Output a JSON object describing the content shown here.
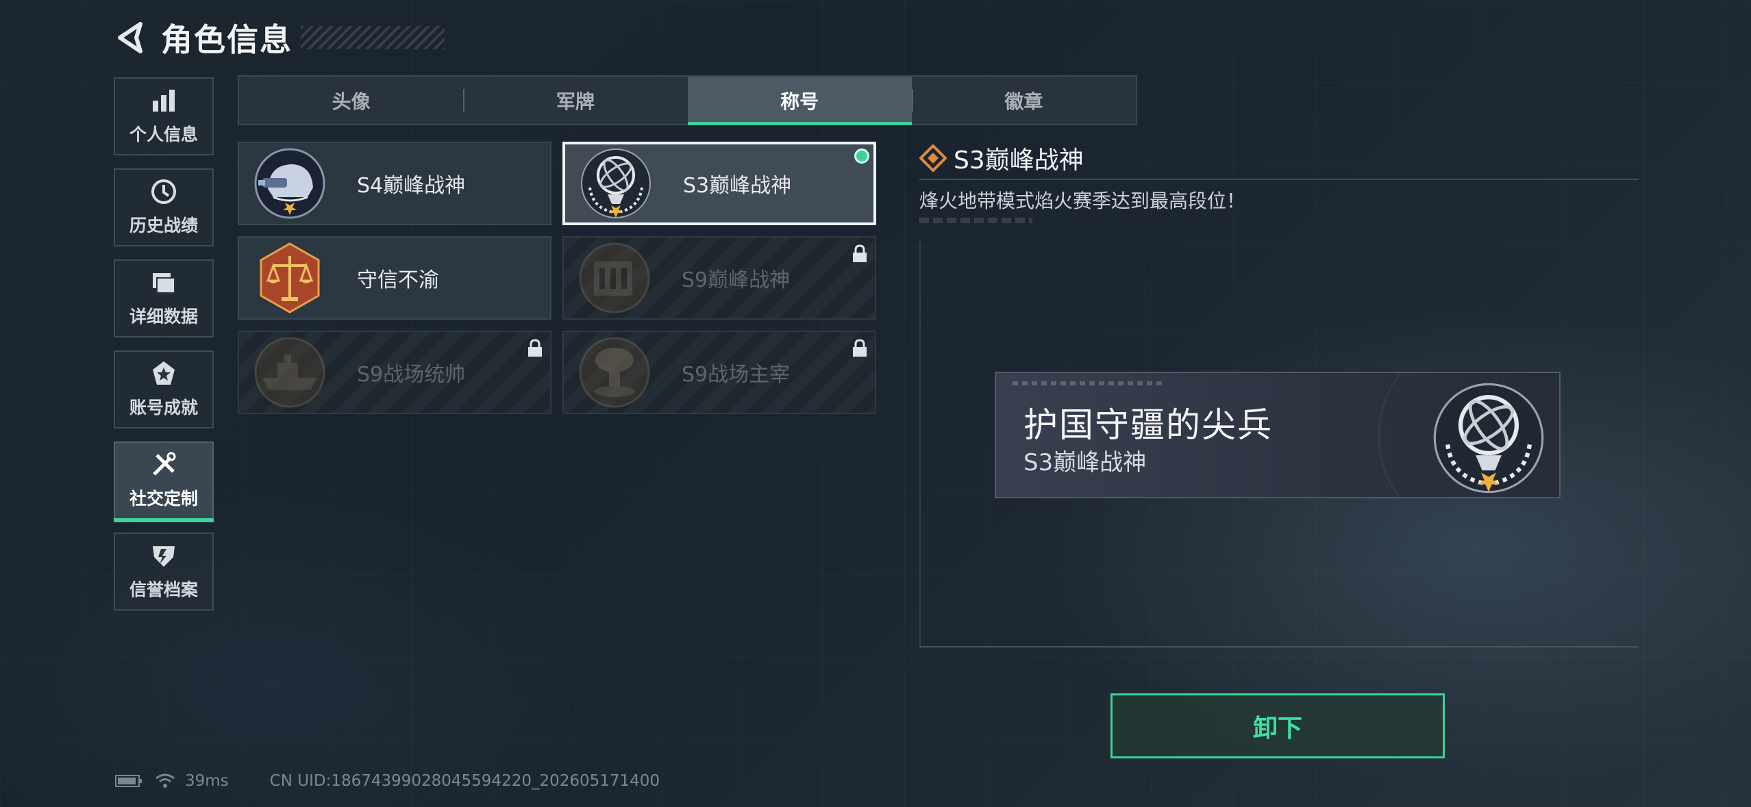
{
  "header": {
    "title": "角色信息"
  },
  "sidebar": {
    "items": [
      {
        "label": "个人信息",
        "icon": "bar-chart-icon"
      },
      {
        "label": "历史战绩",
        "icon": "clock-icon"
      },
      {
        "label": "详细数据",
        "icon": "folder-icon"
      },
      {
        "label": "账号成就",
        "icon": "star-badge-icon"
      },
      {
        "label": "社交定制",
        "icon": "tools-icon",
        "active": true
      },
      {
        "label": "信誉档案",
        "icon": "shield-icon"
      }
    ]
  },
  "tabs": [
    {
      "label": "头像"
    },
    {
      "label": "军牌"
    },
    {
      "label": "称号",
      "active": true
    },
    {
      "label": "徽章"
    }
  ],
  "titles": [
    {
      "name": "S4巅峰战神",
      "emblem": "helmet-emblem",
      "locked": false
    },
    {
      "name": "S3巅峰战神",
      "emblem": "armillary-emblem",
      "locked": false,
      "selected": true,
      "equipped": true
    },
    {
      "name": "守信不渝",
      "emblem": "scales-emblem",
      "locked": false
    },
    {
      "name": "S9巅峰战神",
      "emblem": "fortress-emblem",
      "locked": true
    },
    {
      "name": "S9战场统帅",
      "emblem": "ship-emblem",
      "locked": true
    },
    {
      "name": "S9战场主宰",
      "emblem": "mushroom-cloud-emblem",
      "locked": true
    }
  ],
  "detail": {
    "title": "S3巅峰战神",
    "description": "烽火地带模式焰火赛季达到最高段位！"
  },
  "preview": {
    "main_text": "护国守疆的尖兵",
    "sub_text": "S3巅峰战神"
  },
  "action_button": {
    "label": "卸下"
  },
  "status_bar": {
    "ping": "39ms",
    "uid": "CN UID:18674399028045594220_202605171400"
  },
  "colors": {
    "accent": "#3fd19a",
    "background": "#1c262f",
    "diamond": "#e08a3c"
  }
}
